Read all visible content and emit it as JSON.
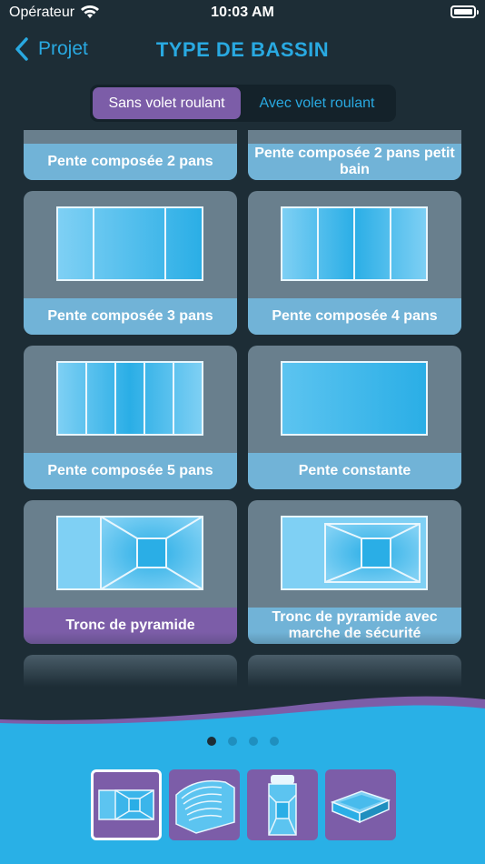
{
  "status": {
    "carrier": "Opérateur",
    "time": "10:03 AM"
  },
  "nav": {
    "back_label": "Projet",
    "title": "TYPE DE BASSIN"
  },
  "segments": [
    {
      "label": "Sans volet roulant",
      "selected": true
    },
    {
      "label": "Avec volet roulant",
      "selected": false
    }
  ],
  "cards": [
    {
      "label": "Pente composée 2 pans",
      "selected": false
    },
    {
      "label": "Pente composée 2 pans petit bain",
      "selected": false
    },
    {
      "label": "Pente composée 3 pans",
      "selected": false
    },
    {
      "label": "Pente composée 4 pans",
      "selected": false
    },
    {
      "label": "Pente composée 5 pans",
      "selected": false
    },
    {
      "label": "Pente constante",
      "selected": false
    },
    {
      "label": "Tronc de pyramide",
      "selected": true
    },
    {
      "label": "Tronc de pyramide avec marche de sécurité",
      "selected": false
    }
  ],
  "pager": {
    "count": 4,
    "active": 0
  },
  "tools": [
    {
      "icon": "pyramid-pool-icon",
      "selected": true
    },
    {
      "icon": "staircase-pool-icon",
      "selected": false
    },
    {
      "icon": "pool-with-ladder-icon",
      "selected": false
    },
    {
      "icon": "3d-pool-icon",
      "selected": false
    }
  ],
  "colors": {
    "accent": "#29a9e1",
    "selected": "#7c5da8",
    "label": "#71b3d7",
    "card": "#697f8d",
    "background": "#1d2d36"
  }
}
